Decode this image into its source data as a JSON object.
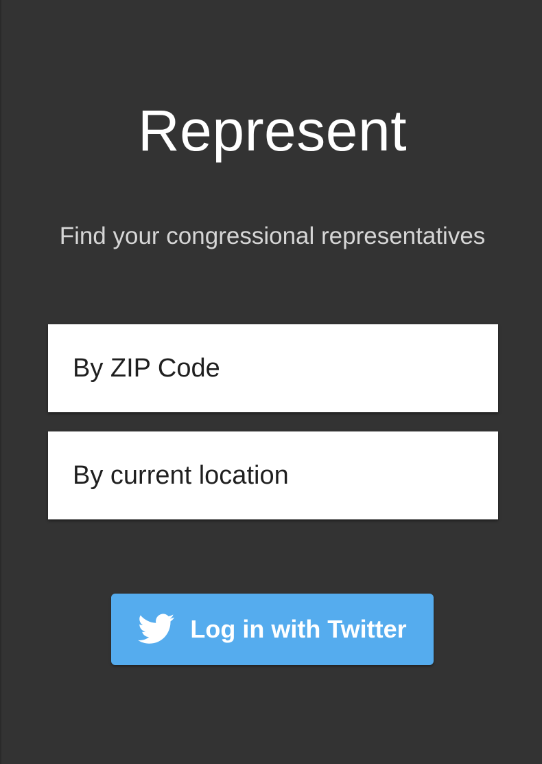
{
  "app": {
    "title": "Represent",
    "subtitle": "Find your congressional representatives"
  },
  "search_options": [
    {
      "label": "By ZIP Code"
    },
    {
      "label": "By current location"
    }
  ],
  "twitter_login": {
    "label": "Log in with Twitter",
    "icon": "twitter-bird-icon",
    "color": "#55acee"
  },
  "colors": {
    "background": "#333333",
    "card": "#ffffff",
    "title_text": "#ffffff",
    "subtitle_text": "#d6d6d6"
  }
}
